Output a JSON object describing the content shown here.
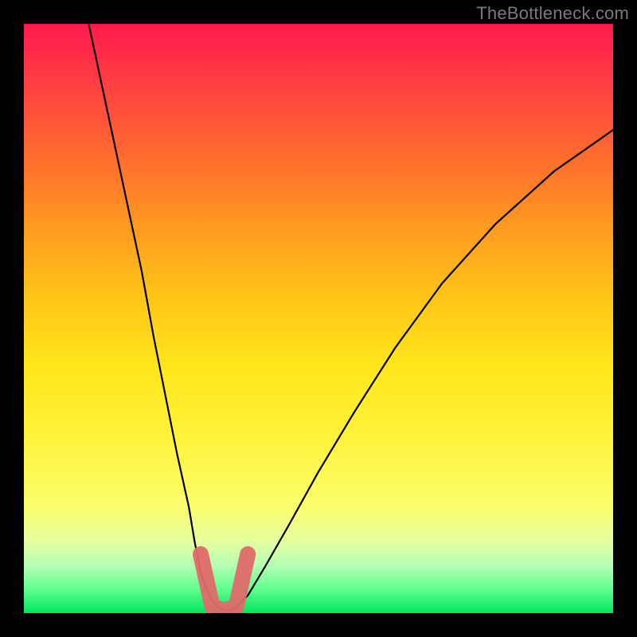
{
  "watermark": "TheBottleneck.com",
  "chart_data": {
    "type": "line",
    "title": "",
    "xlabel": "",
    "ylabel": "",
    "xlim": [
      0,
      100
    ],
    "ylim": [
      0,
      100
    ],
    "grid": false,
    "legend": false,
    "series": [
      {
        "name": "left-curve",
        "x": [
          11,
          14,
          17,
          20,
          22,
          24,
          26,
          28,
          29,
          30,
          31,
          32,
          33
        ],
        "y": [
          100,
          86,
          72,
          58,
          47,
          37,
          27,
          18,
          12,
          7,
          4,
          2,
          1
        ]
      },
      {
        "name": "right-curve",
        "x": [
          36,
          38,
          41,
          45,
          50,
          56,
          63,
          71,
          80,
          90,
          100
        ],
        "y": [
          1,
          3,
          8,
          15,
          24,
          34,
          45,
          56,
          66,
          75,
          82
        ]
      },
      {
        "name": "valley-floor",
        "x": [
          33,
          34,
          35,
          36
        ],
        "y": [
          1,
          0.5,
          0.5,
          1
        ]
      }
    ],
    "annotations": [
      {
        "name": "highlighted-min-region",
        "color": "#e06a6a",
        "x_range": [
          30,
          38
        ],
        "y_range": [
          0,
          10
        ]
      }
    ],
    "gradient_background": {
      "top": "#ff1a4d",
      "mid": "#ffe61a",
      "bottom": "#00e45e"
    }
  }
}
